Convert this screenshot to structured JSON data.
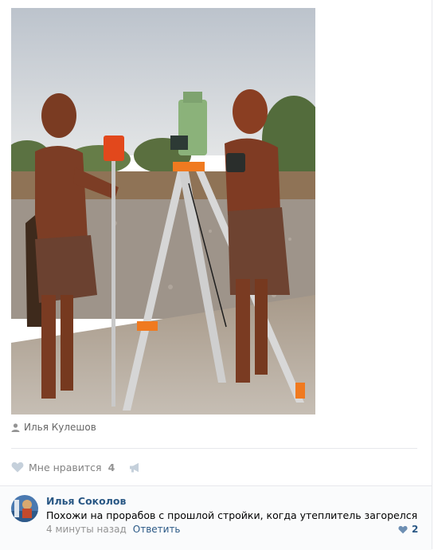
{
  "post": {
    "photo_author": "Илья Кулешов",
    "like_label": "Мне нравится",
    "like_count": "4"
  },
  "comment": {
    "author": "Илья Соколов",
    "text": "Похожи на прорабов с прошлой стройки, когда утеплитель загорелся",
    "time": "4 минуты назад",
    "reply_label": "Ответить",
    "like_count": "2"
  },
  "colors": {
    "link": "#2a5885",
    "muted": "#828282",
    "divider": "#e7e8ec",
    "comment_bg": "#fafbfc",
    "like_heart": "#a0b5ce"
  },
  "icons": [
    "user-icon",
    "heart-icon",
    "megaphone-icon",
    "small-heart-icon"
  ]
}
